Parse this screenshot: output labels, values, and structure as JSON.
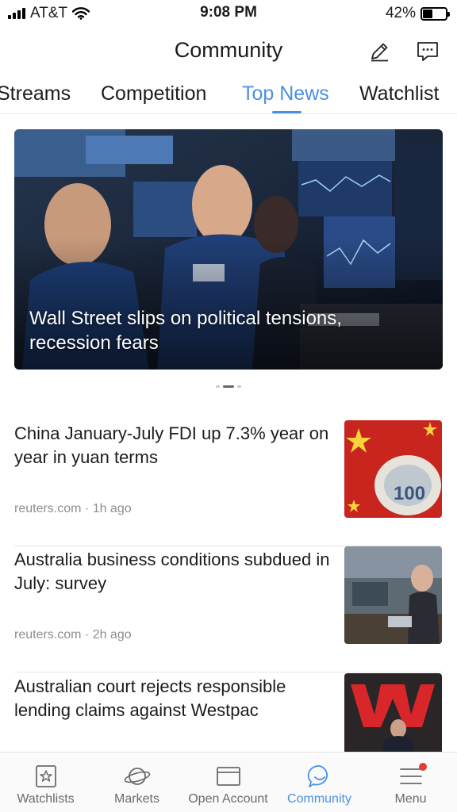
{
  "status_bar": {
    "carrier": "AT&T",
    "time": "9:08 PM",
    "battery_text": "42%",
    "battery_level": 0.42
  },
  "header": {
    "title": "Community",
    "compose_icon": "pencil-icon",
    "chat_icon": "chat-bubble-icon"
  },
  "tabs": [
    {
      "label": "Streams",
      "active": false
    },
    {
      "label": "Competition",
      "active": false
    },
    {
      "label": "Top News",
      "active": true
    },
    {
      "label": "Watchlist",
      "active": false
    }
  ],
  "hero": {
    "caption": "Wall Street slips on political tensions, recession fears",
    "carousel_page": 2,
    "carousel_total": 3
  },
  "news": [
    {
      "title": "China January-July FDI up 7.3% year on year in yuan terms",
      "meta": "reuters.com · 1h ago"
    },
    {
      "title": "Australia business conditions subdued in July: survey",
      "meta": "reuters.com · 2h ago"
    },
    {
      "title": "Australian court rejects responsible lending claims against Westpac",
      "meta": ""
    }
  ],
  "bottom_nav": [
    {
      "label": "Watchlists",
      "icon": "star-icon",
      "active": false
    },
    {
      "label": "Markets",
      "icon": "planet-icon",
      "active": false
    },
    {
      "label": "Open Account",
      "icon": "wallet-icon",
      "active": false
    },
    {
      "label": "Community",
      "icon": "smiley-chat-icon",
      "active": true
    },
    {
      "label": "Menu",
      "icon": "menu-icon",
      "active": false,
      "has_badge": true
    }
  ],
  "colors": {
    "accent": "#4a90e2",
    "badge": "#e53935"
  }
}
